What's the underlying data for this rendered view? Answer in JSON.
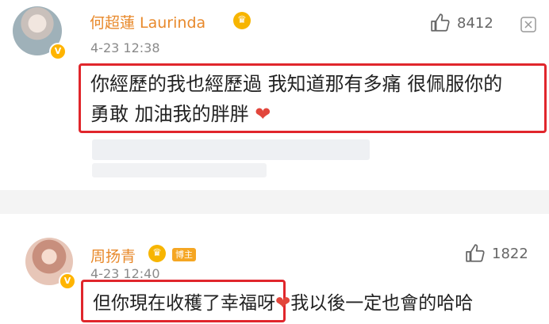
{
  "comment1": {
    "author": "何超蓮 Laurinda",
    "crown_icon": "crown-icon",
    "time": "4-23 12:38",
    "likes": "8412",
    "text_line1": "你經歷的我也經歷過 我知道那有多痛 很佩服你的",
    "text_line2": "勇敢 加油我的胖胖",
    "heart": "❤"
  },
  "comment2": {
    "author": "周扬青",
    "tag": "博主",
    "time": "4-23 12:40",
    "likes": "1822",
    "text": "但你現在收穫了幸福呀",
    "heart": "❤",
    "tail": "我以後一定也會的哈哈"
  },
  "colors": {
    "name": "#e8892b",
    "highlight_border": "#e0262c",
    "heart": "#e2463c"
  }
}
